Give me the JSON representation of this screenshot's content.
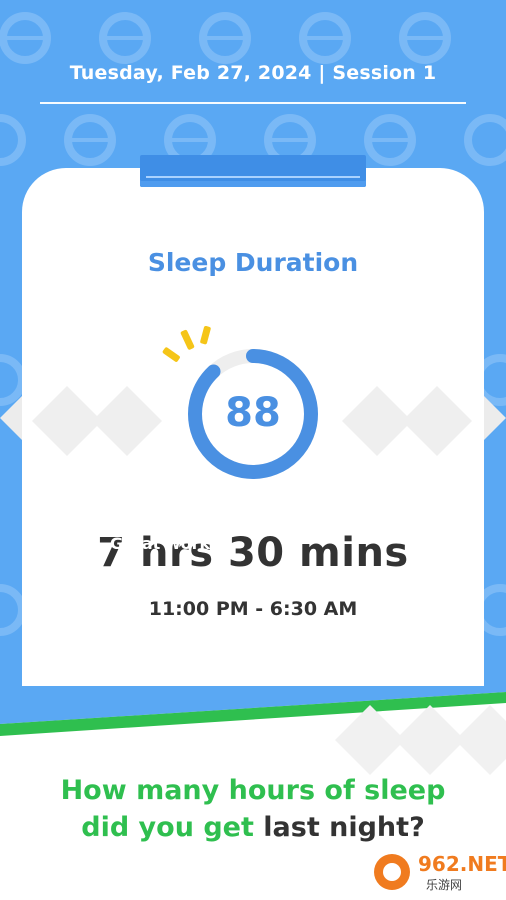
{
  "header": {
    "date_session": "Tuesday, Feb 27, 2024 | Session 1"
  },
  "card": {
    "title": "Sleep Duration",
    "score": "88",
    "score_fraction": 0.88,
    "duration": "7 hrs 30 mins",
    "time_range": "11:00 PM - 6:30 AM",
    "footer_text": "Great work!"
  },
  "question": {
    "part1": "How many hours of sleep",
    "part2": "did you get ",
    "part3": "last night?"
  },
  "watermark": {
    "brand": "962.NET",
    "sub": "乐游网"
  },
  "colors": {
    "background": "#5aa8f3",
    "accent_blue": "#4a90e2",
    "green": "#2fbf4f",
    "sparkle": "#f5c518"
  }
}
